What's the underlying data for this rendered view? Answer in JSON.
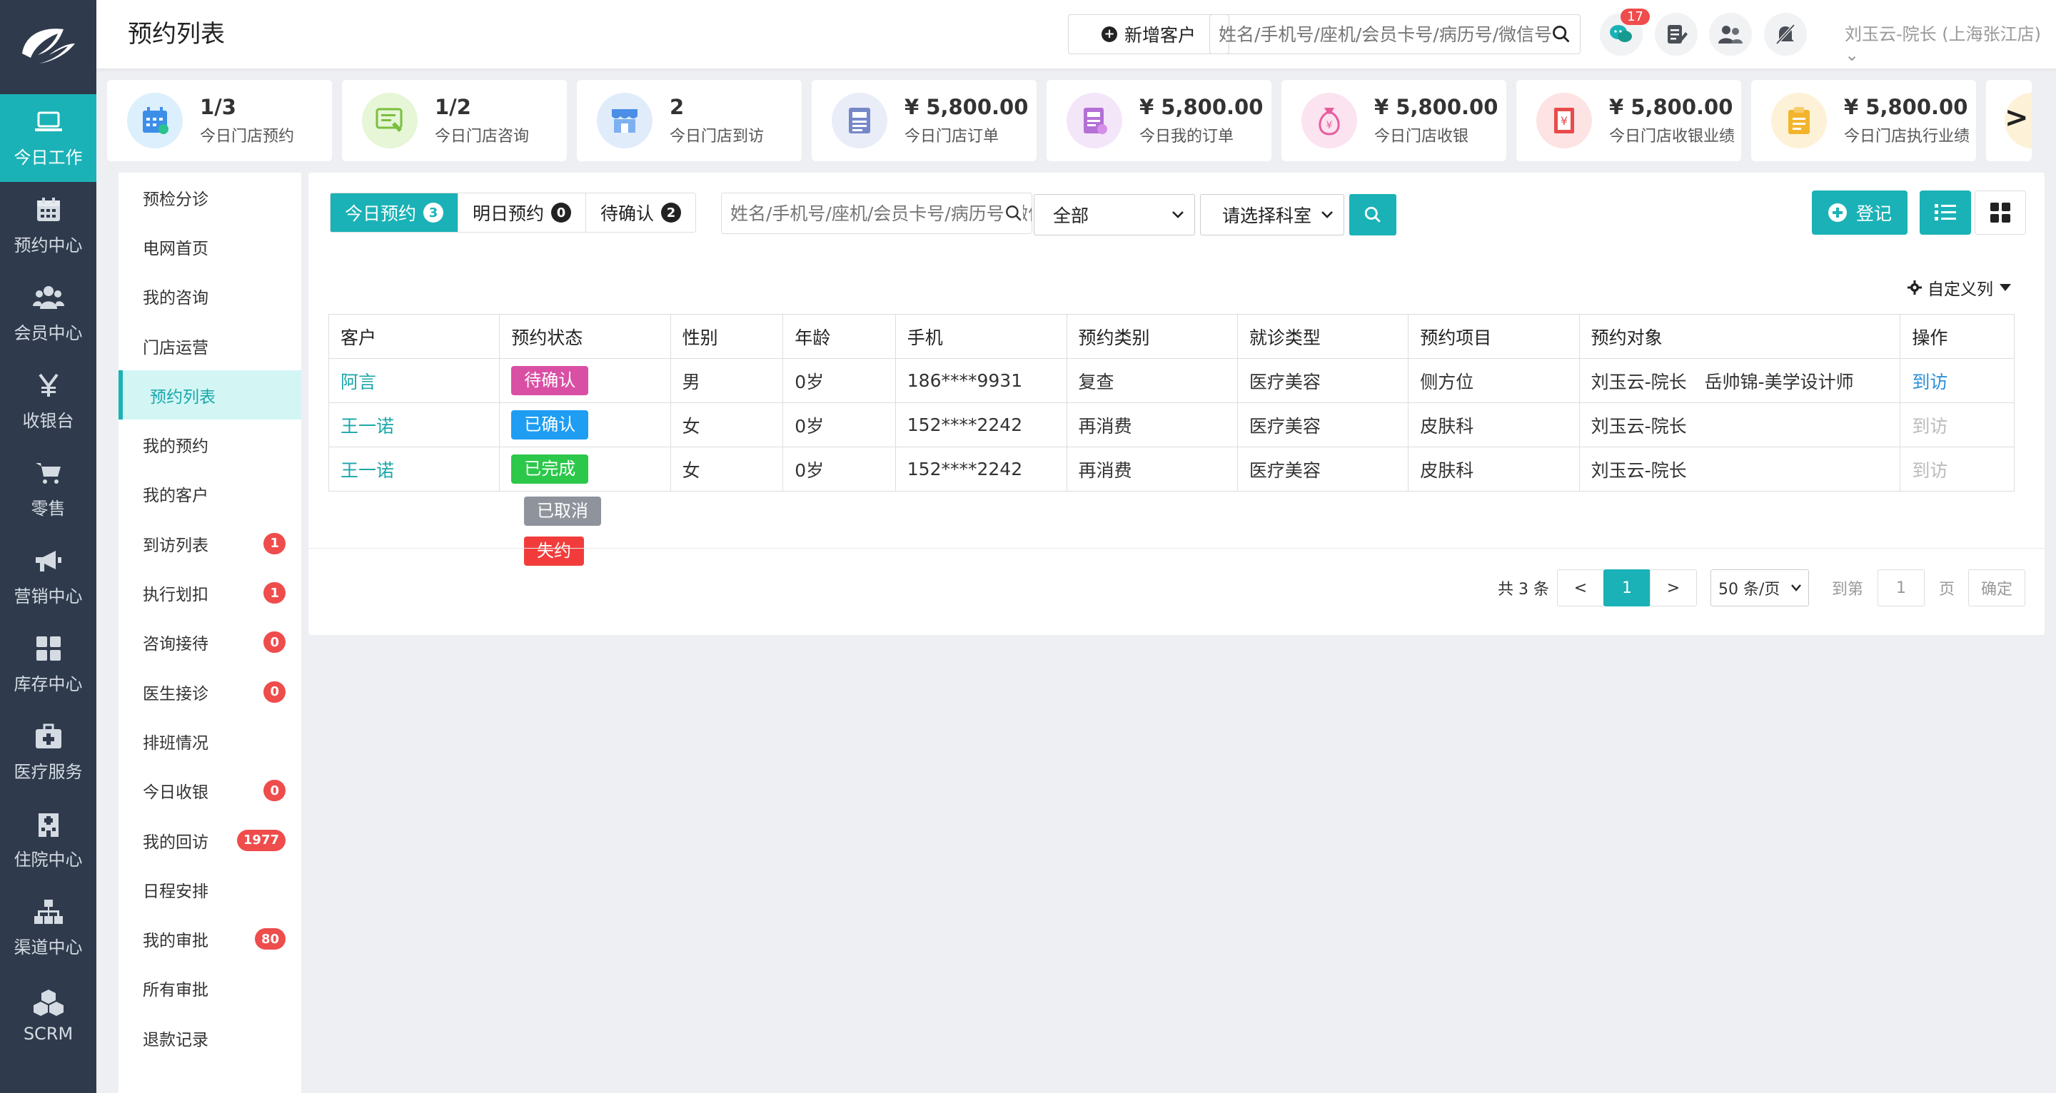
{
  "leftnav": [
    {
      "label": "今日工作",
      "icon": "laptop-icon",
      "active": true
    },
    {
      "label": "预约中心",
      "icon": "calendar-icon"
    },
    {
      "label": "会员中心",
      "icon": "members-icon"
    },
    {
      "label": "收银台",
      "icon": "yen-icon"
    },
    {
      "label": "零售",
      "icon": "cart-icon"
    },
    {
      "label": "营销中心",
      "icon": "megaphone-icon"
    },
    {
      "label": "库存中心",
      "icon": "grid-icon"
    },
    {
      "label": "医疗服务",
      "icon": "medkit-icon"
    },
    {
      "label": "住院中心",
      "icon": "hospital-icon"
    },
    {
      "label": "渠道中心",
      "icon": "org-chart-icon"
    },
    {
      "label": "SCRM",
      "icon": "cubes-icon"
    }
  ],
  "header": {
    "title": "预约列表",
    "add_customer": "新增客户",
    "search_placeholder": "姓名/手机号/座机/会员卡号/病历号/微信号",
    "wechat_badge": "17",
    "user": "刘玉云-院长 (上海张江店)"
  },
  "kpis": [
    {
      "value": "1/3",
      "label": "今日门店预约",
      "icon": "calendar-check-icon",
      "bg": "#dceffd"
    },
    {
      "value": "1/2",
      "label": "今日门店咨询",
      "icon": "consult-icon",
      "bg": "#e6f6d7"
    },
    {
      "value": "2",
      "label": "今日门店到访",
      "icon": "store-icon",
      "bg": "#e1ecfb"
    },
    {
      "value": "¥ 5,800.00",
      "label": "今日门店订单",
      "icon": "order-new-icon",
      "bg": "#e9edf8"
    },
    {
      "value": "¥ 5,800.00",
      "label": "今日我的订单",
      "icon": "my-order-icon",
      "bg": "#f4e6f9"
    },
    {
      "value": "¥ 5,800.00",
      "label": "今日门店收银",
      "icon": "money-bag-icon",
      "bg": "#fbe3ef"
    },
    {
      "value": "¥ 5,800.00",
      "label": "今日门店收银业绩",
      "icon": "receipt-icon",
      "bg": "#fde3e3"
    },
    {
      "value": "¥ 5,800.00",
      "label": "今日门店执行业绩",
      "icon": "clipboard-icon",
      "bg": "#fdf2d7"
    }
  ],
  "kpi_more": ">",
  "subnav": [
    {
      "label": "预检分诊"
    },
    {
      "label": "电网首页"
    },
    {
      "label": "我的咨询"
    },
    {
      "label": "门店运营"
    },
    {
      "label": "预约列表",
      "active": true
    },
    {
      "label": "我的预约"
    },
    {
      "label": "我的客户"
    },
    {
      "label": "到访列表",
      "badge": "1"
    },
    {
      "label": "执行划扣",
      "badge": "1"
    },
    {
      "label": "咨询接待",
      "badge": "0"
    },
    {
      "label": "医生接诊",
      "badge": "0"
    },
    {
      "label": "排班情况"
    },
    {
      "label": "今日收银",
      "badge": "0"
    },
    {
      "label": "我的回访",
      "badge": "1977"
    },
    {
      "label": "日程安排"
    },
    {
      "label": "我的审批",
      "badge": "80"
    },
    {
      "label": "所有审批"
    },
    {
      "label": "退款记录"
    }
  ],
  "tabs": [
    {
      "label": "今日预约",
      "count": "3",
      "active": true
    },
    {
      "label": "明日预约",
      "count": "0"
    },
    {
      "label": "待确认",
      "count": "2"
    }
  ],
  "filter": {
    "search_placeholder": "姓名/手机号/座机/会员卡号/病历号/微信号",
    "status_value": "全部",
    "dept_value": "请选择科室"
  },
  "register_label": "登记",
  "custom_columns": "自定义列",
  "columns": [
    "客户",
    "预约状态",
    "性别",
    "年龄",
    "手机",
    "预约类别",
    "就诊类型",
    "预约项目",
    "预约对象",
    "操作"
  ],
  "rows": [
    {
      "customer": "阿言",
      "status": "待确认",
      "status_color": "#d94fa3",
      "gender": "男",
      "age": "0岁",
      "phone": "186****9931",
      "category": "复查",
      "visit_type": "医疗美容",
      "project": "侧方位",
      "target": "刘玉云-院长　岳帅锦-美学设计师",
      "action": "到访",
      "action_enabled": true
    },
    {
      "customer": "王一诺",
      "status": "已确认",
      "status_color": "#1e9df3",
      "gender": "女",
      "age": "0岁",
      "phone": "152****2242",
      "category": "再消费",
      "visit_type": "医疗美容",
      "project": "皮肤科",
      "target": "刘玉云-院长",
      "action": "到访",
      "action_enabled": false
    },
    {
      "customer": "王一诺",
      "status": "已完成",
      "status_color": "#2cc84a",
      "gender": "女",
      "age": "0岁",
      "phone": "152****2242",
      "category": "再消费",
      "visit_type": "医疗美容",
      "project": "皮肤科",
      "target": "刘玉云-院长",
      "action": "到访",
      "action_enabled": false
    }
  ],
  "status_legend": [
    {
      "label": "已取消",
      "color": "#8f939c"
    },
    {
      "label": "失约",
      "color": "#f23c3c"
    }
  ],
  "pager": {
    "total": "共 3 条",
    "prev": "<",
    "current": "1",
    "next": ">",
    "page_size": "50 条/页",
    "goto_label": "到第",
    "goto_value": "1",
    "page_unit": "页",
    "confirm": "确定"
  }
}
